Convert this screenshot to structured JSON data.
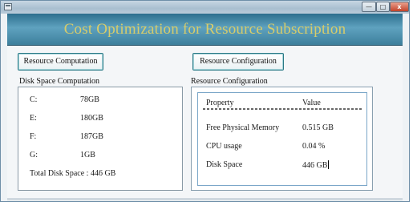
{
  "window": {
    "controls": {
      "minimize": "—",
      "maximize": "□",
      "close": "x"
    }
  },
  "header": {
    "title": "Cost Optimization for Resource Subscription"
  },
  "buttons": {
    "resource_computation": "Resource Computation",
    "resource_configuration": "Resource Configuration"
  },
  "disk": {
    "section_label": "Disk Space Computation",
    "drives": [
      {
        "drive": "C:",
        "size": "78GB"
      },
      {
        "drive": "E:",
        "size": "180GB"
      },
      {
        "drive": "F:",
        "size": "187GB"
      },
      {
        "drive": "G:",
        "size": "1GB"
      }
    ],
    "total": "Total Disk Space : 446 GB"
  },
  "config": {
    "section_label": "Resource Configuration",
    "columns": [
      "Property",
      "Value"
    ],
    "rows": [
      {
        "property": "Free Physical Memory",
        "value": "0.515 GB"
      },
      {
        "property": "CPU usage",
        "value": "0.04 %"
      },
      {
        "property": "Disk Space",
        "value": "446 GB"
      }
    ]
  },
  "colors": {
    "header_gradient": "#5fa2bf",
    "title_text": "#d8cc6a",
    "button_border": "#2a7a86"
  }
}
